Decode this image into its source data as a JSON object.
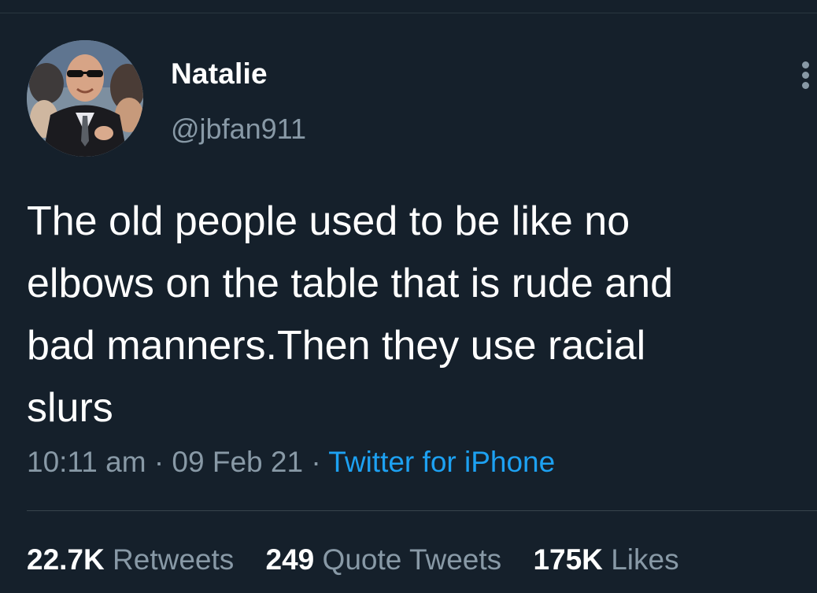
{
  "tweet": {
    "author": {
      "name": "Natalie",
      "handle": "@jbfan911",
      "avatar_icon": "profile-photo-icon"
    },
    "text": "The old people used to be like no\nelbows on the table that is rude and\nbad manners.Then they use racial\nslurs",
    "meta": {
      "time": "10:11 am",
      "separator": "·",
      "date": "09 Feb 21",
      "source": "Twitter for iPhone"
    },
    "stats": {
      "retweets_count": "22.7K",
      "retweets_label": "Retweets",
      "quotes_count": "249",
      "quotes_label": "Quote Tweets",
      "likes_count": "175K",
      "likes_label": "Likes"
    },
    "more_icon": "more-vertical-icon"
  },
  "colors": {
    "background": "#15202b",
    "primary_text": "#ffffff",
    "secondary_text": "#8899a6",
    "link": "#1da1f2",
    "divider": "#38444d"
  }
}
